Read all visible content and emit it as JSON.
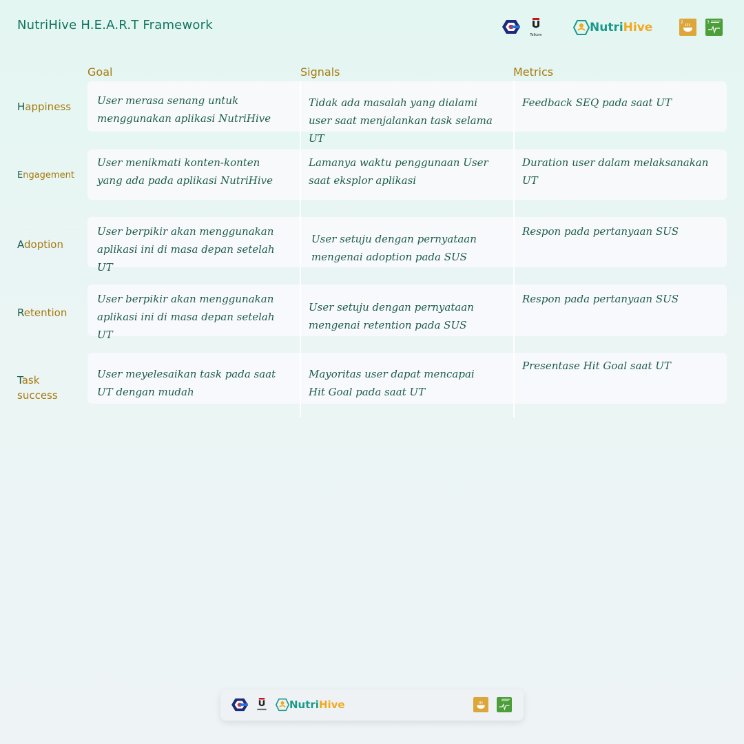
{
  "header": {
    "title": "NutriHive H.E.A.R.T Framework",
    "brand_part1": "Nutri",
    "brand_part2": "Hive",
    "university_label": "Telkom"
  },
  "columns": [
    "Goal",
    "Signals",
    "Metrics"
  ],
  "rows": [
    {
      "initial": "H",
      "rest": "appiness",
      "goal": "User merasa senang untuk menggunakan aplikasi NutriHive",
      "signal": "Tidak ada masalah yang dialami user saat menjalankan task selama UT",
      "metric": "Feedback SEQ pada saat UT"
    },
    {
      "initial": "E",
      "rest": "ngagement",
      "goal": "User menikmati konten-konten yang ada pada aplikasi NutriHive",
      "signal": "Lamanya waktu penggunaan User saat eksplor aplikasi",
      "metric": "Duration user dalam melaksanakan UT"
    },
    {
      "initial": "A",
      "rest": "doption",
      "goal": "User berpikir akan menggunakan aplikasi ini di masa depan setelah UT",
      "signal": "User setuju dengan pernyataan mengenai adoption pada SUS",
      "metric": "Respon pada pertanyaan SUS"
    },
    {
      "initial": "R",
      "rest": "etention",
      "goal": "User berpikir akan menggunakan aplikasi ini di masa depan setelah UT",
      "signal": "User setuju dengan pernyataan mengenai retention pada SUS",
      "metric": "Respon pada pertanyaan SUS"
    },
    {
      "initial": "T",
      "rest": "ask success",
      "goal": "User meyelesaikan task pada saat UT dengan mudah",
      "signal": "Mayoritas user dapat mencapai Hit Goal pada saat UT",
      "metric": "Presentase Hit Goal saat UT"
    }
  ],
  "footer": {
    "brand_part1": "Nutri",
    "brand_part2": "Hive"
  },
  "icons": {
    "logo1": "rsb-logo-icon",
    "logo2": "telkom-university-logo-icon",
    "logo3": "nutrihive-logo-icon",
    "sdg_a": "sdg-2-zero-hunger-icon",
    "sdg_b": "sdg-3-good-health-icon"
  },
  "colors": {
    "heading": "#a6790f",
    "text": "#1d5c4a",
    "title": "#127560",
    "brand_teal": "#1a9a8a",
    "brand_orange": "#f2a81f",
    "sdg2": "#dda63a",
    "sdg3": "#4c9f38"
  }
}
